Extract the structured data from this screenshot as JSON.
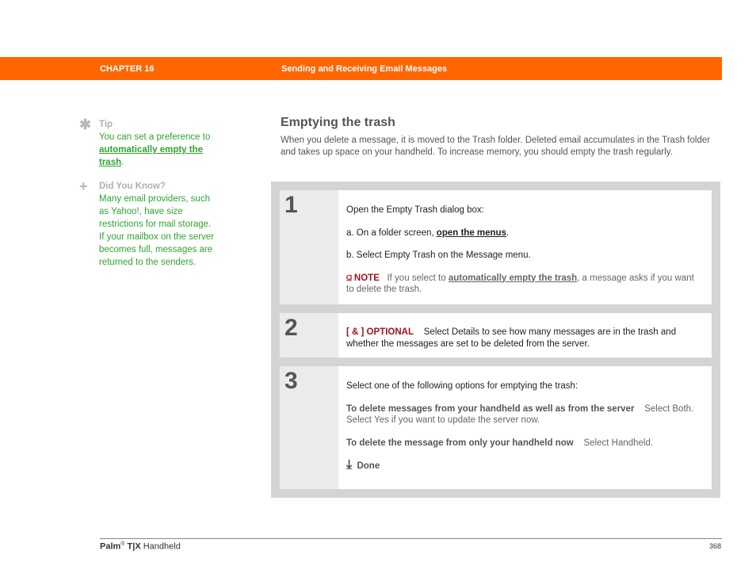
{
  "header": {
    "chapter": "CHAPTER 16",
    "title": "Sending and Receiving Email Messages",
    "color": "#ff6600"
  },
  "sidebar": {
    "tip": {
      "icon": "asterisk-icon",
      "label": "Tip",
      "text_before": "You can set a preference to ",
      "link": "automatically empty the trash",
      "text_after": "."
    },
    "did_you_know": {
      "icon": "plus-icon",
      "label": "Did You Know?",
      "text": "Many email providers, such as Yahoo!, have size restrictions for mail storage. If your mailbox on the server becomes full, messages are returned to the senders."
    }
  },
  "main": {
    "title": "Emptying the trash",
    "intro": "When you delete a message, it is moved to the Trash folder. Deleted email accumulates in the Trash folder and takes up space on your handheld. To increase memory, you should empty the trash regularly."
  },
  "steps": [
    {
      "number": "1",
      "intro": "Open the Empty Trash dialog box:",
      "a_prefix": "a.  On a folder screen, ",
      "a_link": "open the menus",
      "a_suffix": ".",
      "b": "b.  Select Empty Trash on the Message menu.",
      "note_label": "NOTE",
      "note_before": "If you select to ",
      "note_link": "automatically empty the trash",
      "note_after": ", a message asks if you want to delete the trash."
    },
    {
      "number": "2",
      "optional_label": "[ & ]  OPTIONAL",
      "text": "Select Details to see how many messages are in the trash and whether the messages are set to be deleted from the server."
    },
    {
      "number": "3",
      "intro": "Select one of the following options for emptying the trash:",
      "option1_bold": "To delete messages from your handheld as well as from the server",
      "option1_text": "Select Both. Select Yes if you want to update the server now.",
      "option2_bold": "To delete the message from only your handheld now",
      "option2_text": "Select Handheld.",
      "done": "Done"
    }
  ],
  "footer": {
    "brand": "Palm",
    "reg": "®",
    "model": "T|X",
    "product": "Handheld",
    "page": "368"
  }
}
